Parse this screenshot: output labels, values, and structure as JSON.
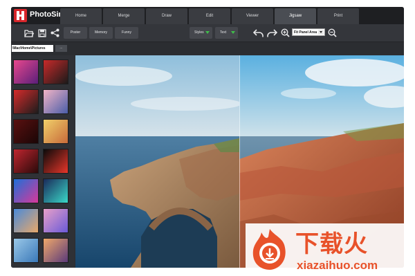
{
  "app": {
    "name": "PhotoSir"
  },
  "tabs": [
    {
      "label": "Home",
      "active": false
    },
    {
      "label": "Merge",
      "active": false
    },
    {
      "label": "Draw",
      "active": false
    },
    {
      "label": "Edit",
      "active": false
    },
    {
      "label": "Viewer",
      "active": false
    },
    {
      "label": "Jigsaw",
      "active": true
    },
    {
      "label": "Print",
      "active": false
    }
  ],
  "toolbar": {
    "open_icon": "folder-open-icon",
    "save_icon": "save-icon",
    "share_icon": "share-icon",
    "buttons": [
      "Poster",
      "Memory",
      "Funny"
    ],
    "styles_label": "Styles",
    "text_label": "Text",
    "undo_icon": "undo-icon",
    "redo_icon": "redo-icon",
    "zoom_in_icon": "zoom-in-icon",
    "zoom_value": "Fit Panel Area",
    "zoom_out_icon": "zoom-out-icon"
  },
  "pathbar": {
    "path": "\\Mac\\Home\\Pictures",
    "browse_label": "..."
  },
  "thumbnails": [
    {
      "name": "thumb-neon-portrait",
      "c1": "#e8478d",
      "c2": "#5a1f7a"
    },
    {
      "name": "thumb-red-selfie",
      "c1": "#c82a2a",
      "c2": "#1a1a1a"
    },
    {
      "name": "thumb-camera-girl",
      "c1": "#d62b2b",
      "c2": "#1c1c1c"
    },
    {
      "name": "thumb-pink-hair",
      "c1": "#f2b4c6",
      "c2": "#4a5da8"
    },
    {
      "name": "thumb-dark-red",
      "c1": "#5a1010",
      "c2": "#1a0606"
    },
    {
      "name": "thumb-colorful-hands",
      "c1": "#f0d06a",
      "c2": "#c86a3a"
    },
    {
      "name": "thumb-red-portrait",
      "c1": "#c0252f",
      "c2": "#2a0a0a"
    },
    {
      "name": "thumb-betta-fish",
      "c1": "#0a0a0a",
      "c2": "#e8362a"
    },
    {
      "name": "thumb-neon-street",
      "c1": "#1e6fd8",
      "c2": "#d8389a"
    },
    {
      "name": "thumb-aurora",
      "c1": "#1a2a5a",
      "c2": "#3ad8c8"
    },
    {
      "name": "thumb-desert-tree",
      "c1": "#4a8ad8",
      "c2": "#e8a86a"
    },
    {
      "name": "thumb-pink-sky",
      "c1": "#e8a0c8",
      "c2": "#6a5ad8"
    },
    {
      "name": "thumb-blue-sea",
      "c1": "#9ac8e8",
      "c2": "#3a78b8"
    },
    {
      "name": "thumb-sunset-rock",
      "c1": "#f0a86a",
      "c2": "#5a3a7a"
    }
  ],
  "watermark": {
    "title": "下载火",
    "url": "xiazaihuo.com"
  },
  "colors": {
    "accent_green": "#3fbf4a",
    "brand_red": "#d8262b",
    "watermark_orange": "#e8522a"
  }
}
